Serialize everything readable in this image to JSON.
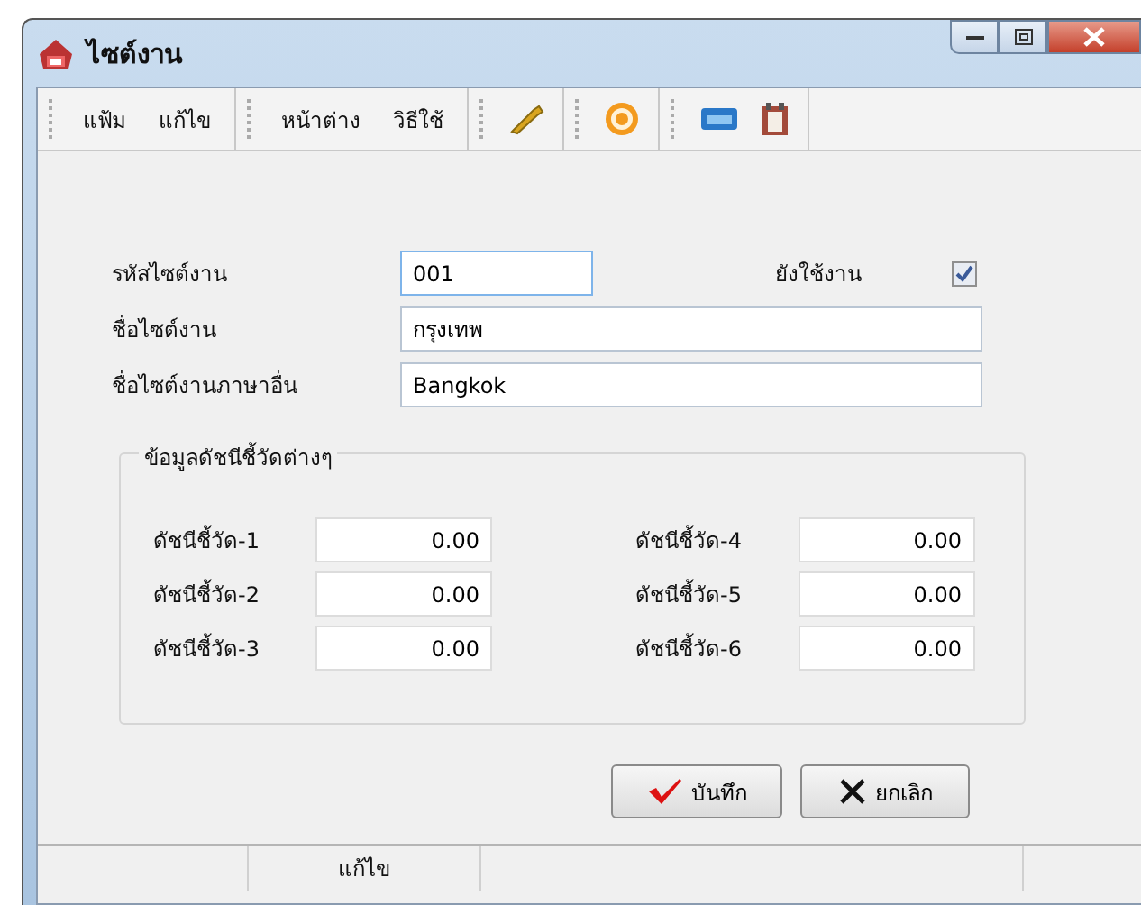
{
  "window": {
    "title": "ไซต์งาน"
  },
  "menu_groups": [
    [
      "แฟ้ม",
      "แก้ไข"
    ],
    [
      "หน้าต่าง",
      "วิธีใช้"
    ]
  ],
  "form": {
    "code": {
      "label": "รหัสไซต์งาน",
      "value": "001"
    },
    "active": {
      "label": "ยังใช้งาน",
      "checked": true
    },
    "name": {
      "label": "ชื่อไซต์งาน",
      "value": "กรุงเทพ"
    },
    "alt_name": {
      "label": "ชื่อไซต์งานภาษาอื่น",
      "value": "Bangkok"
    }
  },
  "indicators": {
    "title": "ข้อมูลดัชนีชี้วัดต่างๆ",
    "items": [
      {
        "label": "ดัชนีชี้วัด-1",
        "value": "0.00"
      },
      {
        "label": "ดัชนีชี้วัด-2",
        "value": "0.00"
      },
      {
        "label": "ดัชนีชี้วัด-3",
        "value": "0.00"
      },
      {
        "label": "ดัชนีชี้วัด-4",
        "value": "0.00"
      },
      {
        "label": "ดัชนีชี้วัด-5",
        "value": "0.00"
      },
      {
        "label": "ดัชนีชี้วัด-6",
        "value": "0.00"
      }
    ]
  },
  "buttons": [
    {
      "kind": "save",
      "label": "บันทึก"
    },
    {
      "kind": "cancel",
      "label": "ยกเลิก"
    }
  ],
  "status_bar": {
    "mode": "แก้ไข"
  }
}
